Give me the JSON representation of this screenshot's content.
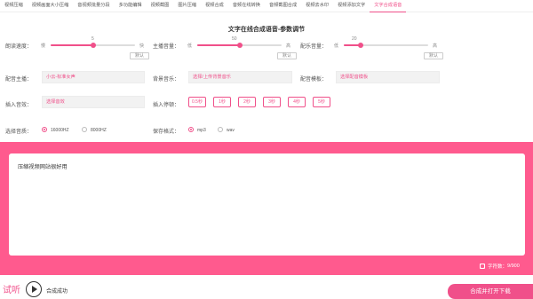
{
  "nav": {
    "items": [
      "视频压缩",
      "视频画面大小压缩",
      "音视频批量分段",
      "多功能编辑",
      "视频截图",
      "图片压缩",
      "视频合成",
      "音频在线转换",
      "音频截图合成",
      "视频去水印",
      "视频添加文字",
      "文字合成语音"
    ],
    "active_index": 11
  },
  "page": {
    "title": "文字在线合成语音-参数调节"
  },
  "sliders": {
    "speed": {
      "label": "朗读速度：",
      "min_label": "慢",
      "max_label": "快",
      "value": "5",
      "fraction": 0.5
    },
    "volume": {
      "label": "主播音量：",
      "min_label": "低",
      "max_label": "高",
      "value": "50",
      "fraction": 0.5,
      "default_label": "默认"
    },
    "music_volume": {
      "label": "配乐音量：",
      "min_label": "低",
      "max_label": "高",
      "value": "20",
      "fraction": 0.2,
      "default_label": "默认"
    },
    "speed_default_label": "默认"
  },
  "fields": {
    "voice": {
      "label": "配音主播：",
      "value": "小云-标准女声"
    },
    "bgm": {
      "label": "背景音乐：",
      "value": "选择/上传背景音乐"
    },
    "template": {
      "label": "配音模板：",
      "value": "选择配音模板"
    },
    "effect": {
      "label": "插入音效：",
      "value": "选择音效"
    }
  },
  "pauses": {
    "label": "插入停顿：",
    "options": [
      "0.5秒",
      "1秒",
      "2秒",
      "3秒",
      "4秒",
      "5秒"
    ]
  },
  "sample_rate": {
    "label": "选择音质：",
    "options": [
      "16000HZ",
      "8000HZ"
    ],
    "selected": 0
  },
  "format": {
    "label": "保存格式：",
    "options": [
      "mp3",
      "wav"
    ],
    "selected": 0
  },
  "editor": {
    "text": "压缩视频网站很好用",
    "char_count_label": "字符数：",
    "char_count": "9/900"
  },
  "footer": {
    "try_label": "试听",
    "status": "合成成功",
    "download_label": "合成并打开下载"
  },
  "colors": {
    "accent": "#f0508a",
    "band": "#ff5a8e"
  }
}
